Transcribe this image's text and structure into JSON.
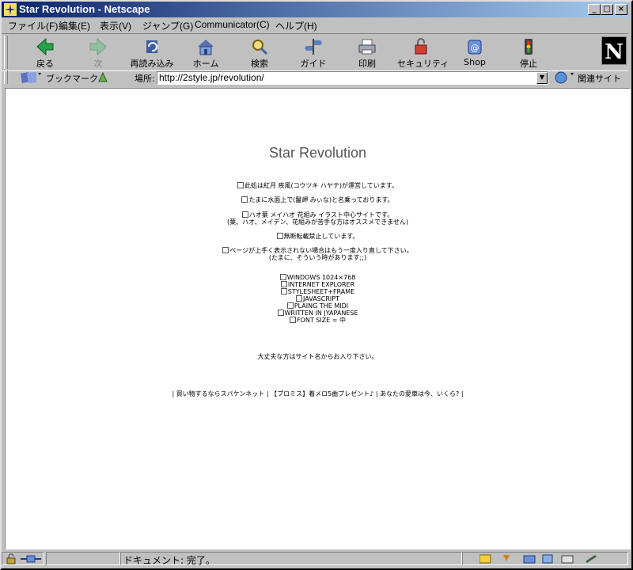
{
  "window": {
    "title": "Star Revolution - Netscape"
  },
  "menu": [
    "ファイル(F)",
    "編集(E)",
    "表示(V)",
    "ジャンプ(G)",
    "Communicator(C)",
    "ヘルプ(H)"
  ],
  "toolbar": [
    {
      "label": "戻る",
      "icon": "back-icon",
      "enabled": true
    },
    {
      "label": "次",
      "icon": "forward-icon",
      "enabled": false
    },
    {
      "label": "再読み込み",
      "icon": "reload-icon",
      "enabled": true
    },
    {
      "label": "ホーム",
      "icon": "home-icon",
      "enabled": true
    },
    {
      "label": "検索",
      "icon": "search-icon",
      "enabled": true
    },
    {
      "label": "ガイド",
      "icon": "guide-icon",
      "enabled": true
    },
    {
      "label": "印刷",
      "icon": "print-icon",
      "enabled": true
    },
    {
      "label": "セキュリティ",
      "icon": "security-icon",
      "enabled": true
    },
    {
      "label": "Shop",
      "icon": "shop-icon",
      "enabled": true
    },
    {
      "label": "停止",
      "icon": "stop-icon",
      "enabled": true
    }
  ],
  "location": {
    "bookmarks_label": "ブックマーク",
    "location_label": "場所:",
    "url": "http://2style.jp/revolution/",
    "related_label": "関連サイト"
  },
  "page": {
    "title": "Star Revolution",
    "p1": "此処は紅月 疾風(コウツキ ハヤテ)が運営しています。",
    "p2": "たまに水面上で(鬣岬 みぃな)と名乗っております。",
    "p3a": "ハオ葉 メイハオ 花組み イラスト中心サイトです。",
    "p3b": "(葉、ハオ、メイデン、花組みが苦手な方はオススメできません)",
    "p4": "無断転載禁止しています。",
    "p5a": "ページが上手く表示されない場合はもう一度入り直して下さい。",
    "p5b": "(たまに、そういう時があります;;)",
    "env": [
      "WINDOWS 1024×768",
      "INTERNET EXPLORER",
      "STYLESHEET+FRAME",
      "JAVASCRIPT",
      "PLAING THE MIDI",
      "WRITTEN IN JYAPANESE",
      "FONT SIZE = 中"
    ],
    "enter": "大丈夫な方はサイト名からお入り下さい。",
    "ads": [
      "買い物するならスパケンネット",
      "【プロミス】着メロ5曲プレゼント♪",
      "あなたの愛車は今、いくら?"
    ]
  },
  "status": {
    "text": "ドキュメント: 完了。"
  }
}
